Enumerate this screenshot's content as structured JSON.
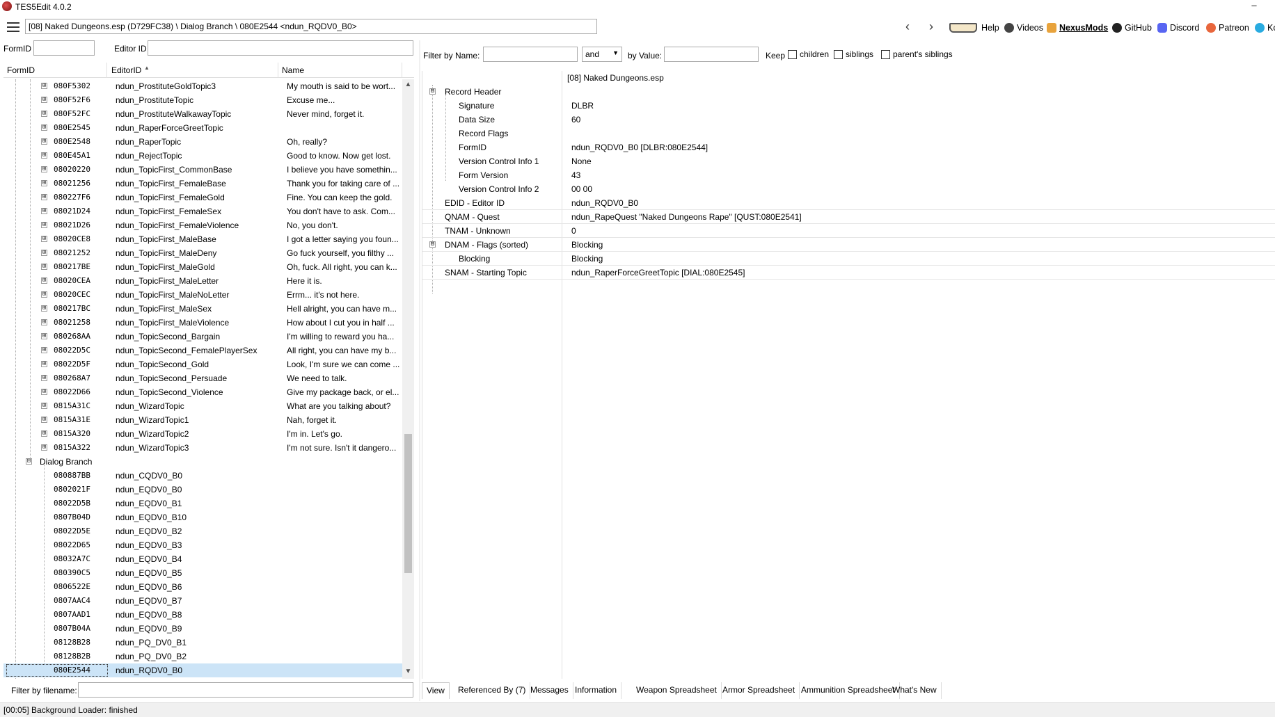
{
  "window": {
    "title": "TES5Edit 4.0.2",
    "minimize": "–"
  },
  "toolbar": {
    "path": "[08] Naked Dungeons.esp (D729FC38) \\ Dialog Branch \\ 080E2544 <ndun_RQDV0_B0>",
    "back": "‹",
    "forward": "›",
    "help": "Help",
    "videos": "Videos",
    "nexusmods": "NexusMods",
    "github": "GitHub",
    "discord": "Discord",
    "patreon": "Patreon",
    "kofi": "Ko"
  },
  "left": {
    "formid_label": "FormID",
    "editorid_label": "Editor ID",
    "columns": {
      "formid": "FormID",
      "editorid": "EditorID",
      "name": "Name",
      "sort_arrow": "▲"
    },
    "topics": [
      {
        "fid": "080F5302",
        "eid": "ndun_ProstituteGoldTopic3",
        "name": "My mouth is said to be wort..."
      },
      {
        "fid": "080F52F6",
        "eid": "ndun_ProstituteTopic",
        "name": "Excuse me..."
      },
      {
        "fid": "080F52FC",
        "eid": "ndun_ProstituteWalkawayTopic",
        "name": "Never mind, forget it."
      },
      {
        "fid": "080E2545",
        "eid": "ndun_RaperForceGreetTopic",
        "name": ""
      },
      {
        "fid": "080E2548",
        "eid": "ndun_RaperTopic",
        "name": "Oh, really?"
      },
      {
        "fid": "080E45A1",
        "eid": "ndun_RejectTopic",
        "name": "Good to know. Now get lost."
      },
      {
        "fid": "08020220",
        "eid": "ndun_TopicFirst_CommonBase",
        "name": "I believe you have somethin..."
      },
      {
        "fid": "08021256",
        "eid": "ndun_TopicFirst_FemaleBase",
        "name": "Thank you for taking care of ..."
      },
      {
        "fid": "080227F6",
        "eid": "ndun_TopicFirst_FemaleGold",
        "name": "Fine. You can keep the gold."
      },
      {
        "fid": "08021D24",
        "eid": "ndun_TopicFirst_FemaleSex",
        "name": "You don't have to ask. Com..."
      },
      {
        "fid": "08021D26",
        "eid": "ndun_TopicFirst_FemaleViolence",
        "name": "No, you don't."
      },
      {
        "fid": "08020CE8",
        "eid": "ndun_TopicFirst_MaleBase",
        "name": "I got a letter saying you foun..."
      },
      {
        "fid": "08021252",
        "eid": "ndun_TopicFirst_MaleDeny",
        "name": "Go fuck yourself, you filthy ..."
      },
      {
        "fid": "080217BE",
        "eid": "ndun_TopicFirst_MaleGold",
        "name": "Oh, fuck. All right, you can k..."
      },
      {
        "fid": "08020CEA",
        "eid": "ndun_TopicFirst_MaleLetter",
        "name": "Here it is."
      },
      {
        "fid": "08020CEC",
        "eid": "ndun_TopicFirst_MaleNoLetter",
        "name": "Errm... it's not here."
      },
      {
        "fid": "080217BC",
        "eid": "ndun_TopicFirst_MaleSex",
        "name": "Hell alright, you can have m..."
      },
      {
        "fid": "08021258",
        "eid": "ndun_TopicFirst_MaleViolence",
        "name": "How about I cut you in half ..."
      },
      {
        "fid": "080268AA",
        "eid": "ndun_TopicSecond_Bargain",
        "name": "I'm willing to reward you ha..."
      },
      {
        "fid": "08022D5C",
        "eid": "ndun_TopicSecond_FemalePlayerSex",
        "name": "All right, you can have my b..."
      },
      {
        "fid": "08022D5F",
        "eid": "ndun_TopicSecond_Gold",
        "name": "Look, I'm sure we can come ..."
      },
      {
        "fid": "080268A7",
        "eid": "ndun_TopicSecond_Persuade",
        "name": "We need to talk."
      },
      {
        "fid": "08022D66",
        "eid": "ndun_TopicSecond_Violence",
        "name": "Give my package back, or el..."
      },
      {
        "fid": "0815A31C",
        "eid": "ndun_WizardTopic",
        "name": "What are you talking about?"
      },
      {
        "fid": "0815A31E",
        "eid": "ndun_WizardTopic1",
        "name": "Nah, forget it."
      },
      {
        "fid": "0815A320",
        "eid": "ndun_WizardTopic2",
        "name": "I'm in. Let's go."
      },
      {
        "fid": "0815A322",
        "eid": "ndun_WizardTopic3",
        "name": "I'm not sure. Isn't it dangero..."
      }
    ],
    "group_label": "Dialog Branch",
    "branches": [
      {
        "fid": "080887BB",
        "eid": "ndun_CQDV0_B0"
      },
      {
        "fid": "0802021F",
        "eid": "ndun_EQDV0_B0"
      },
      {
        "fid": "08022D5B",
        "eid": "ndun_EQDV0_B1"
      },
      {
        "fid": "0807B04D",
        "eid": "ndun_EQDV0_B10"
      },
      {
        "fid": "08022D5E",
        "eid": "ndun_EQDV0_B2"
      },
      {
        "fid": "08022D65",
        "eid": "ndun_EQDV0_B3"
      },
      {
        "fid": "08032A7C",
        "eid": "ndun_EQDV0_B4"
      },
      {
        "fid": "080390C5",
        "eid": "ndun_EQDV0_B5"
      },
      {
        "fid": "0806522E",
        "eid": "ndun_EQDV0_B6"
      },
      {
        "fid": "0807AAC4",
        "eid": "ndun_EQDV0_B7"
      },
      {
        "fid": "0807AAD1",
        "eid": "ndun_EQDV0_B8"
      },
      {
        "fid": "0807B04A",
        "eid": "ndun_EQDV0_B9"
      },
      {
        "fid": "08128B28",
        "eid": "ndun_PQ_DV0_B1"
      },
      {
        "fid": "08128B2B",
        "eid": "ndun_PQ_DV0_B2"
      },
      {
        "fid": "080E2544",
        "eid": "ndun_RQDV0_B0"
      }
    ],
    "filter_filename_label": "Filter by filename:"
  },
  "right": {
    "filter_name_label": "Filter by Name:",
    "and_value": "and",
    "by_value_label": "by Value:",
    "keep_label": "Keep",
    "children_label": "children",
    "siblings_label": "siblings",
    "parents_siblings_label": "parent's siblings",
    "file_header": "[08] Naked Dungeons.esp",
    "record_header": "Record Header",
    "header_fields": [
      {
        "k": "Signature",
        "v": "DLBR"
      },
      {
        "k": "Data Size",
        "v": "60"
      },
      {
        "k": "Record Flags",
        "v": ""
      },
      {
        "k": "FormID",
        "v": "ndun_RQDV0_B0 [DLBR:080E2544]"
      },
      {
        "k": "Version Control Info 1",
        "v": "None"
      },
      {
        "k": "Form Version",
        "v": "43"
      },
      {
        "k": "Version Control Info 2",
        "v": "00 00"
      }
    ],
    "fields": [
      {
        "k": "EDID - Editor ID",
        "v": "ndun_RQDV0_B0"
      },
      {
        "k": "QNAM - Quest",
        "v": "ndun_RapeQuest \"Naked Dungeons Rape\" [QUST:080E2541]"
      },
      {
        "k": "TNAM - Unknown",
        "v": "0"
      },
      {
        "k": "DNAM - Flags (sorted)",
        "v": "Blocking"
      },
      {
        "k": "Blocking",
        "v": "Blocking"
      },
      {
        "k": "SNAM - Starting Topic",
        "v": "ndun_RaperForceGreetTopic [DIAL:080E2545]"
      }
    ]
  },
  "tabs": [
    "View",
    "Referenced By (7)",
    "Messages",
    "Information",
    "Weapon Spreadsheet",
    "Armor Spreadsheet",
    "Ammunition Spreadsheet",
    "What's New"
  ],
  "status": "[00:05] Background Loader: finished",
  "icons": {
    "expand": "⊞",
    "collapse": "⊟"
  }
}
